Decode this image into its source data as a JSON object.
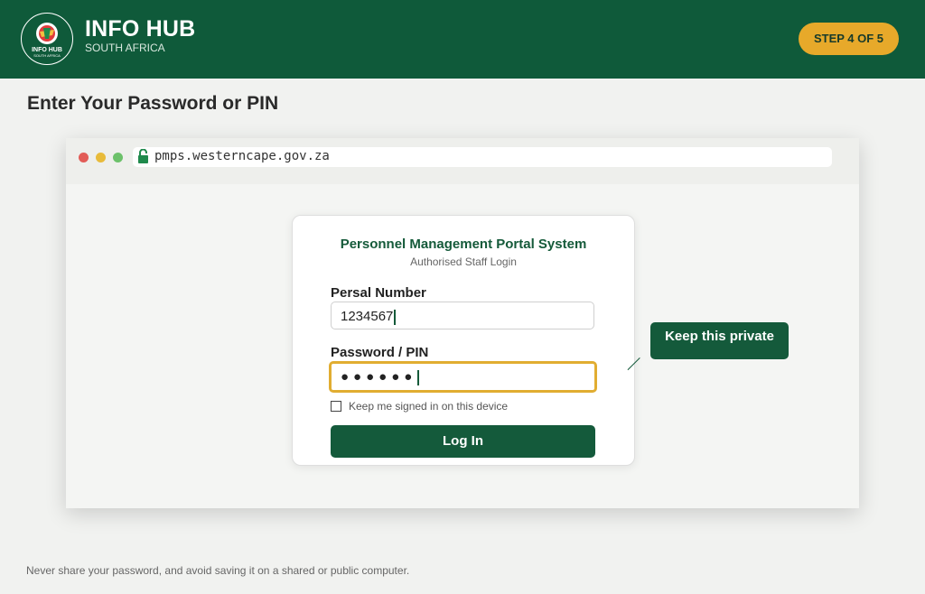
{
  "header": {
    "brand_title": "INFO HUB",
    "brand_subtitle": "SOUTH AFRICA",
    "step_badge": "STEP 4 OF 5",
    "logo_text_top": "INFO HUB",
    "logo_text_bottom": "SOUTH AFRICA"
  },
  "page": {
    "title": "Enter Your Password or PIN",
    "footer_note": "Never share your password, and avoid saving it on a shared or public computer."
  },
  "browser": {
    "url": "pmps.westerncape.gov.za"
  },
  "login_card": {
    "title": "Personnel Management Portal System",
    "subtitle": "Authorised Staff Login",
    "persal_label": "Persal Number",
    "persal_value": "1234567",
    "password_label": "Password / PIN",
    "password_mask": "●●●●●●",
    "remember_label": "Keep me signed in on this device",
    "remember_checked": false,
    "login_button": "Log In"
  },
  "tooltip": {
    "text": "Keep this private"
  },
  "colors": {
    "header_green": "#0f5a3a",
    "badge_yellow": "#e7a92a",
    "button_green": "#145a3b"
  }
}
